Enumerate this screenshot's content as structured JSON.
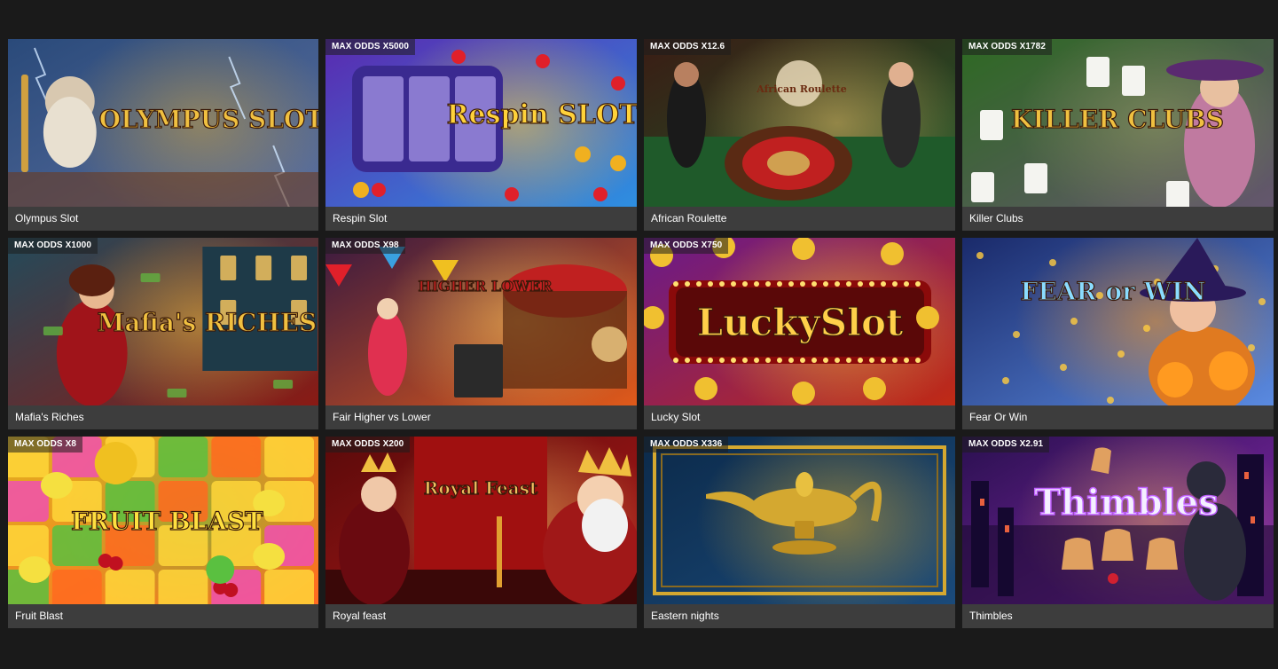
{
  "games": [
    {
      "title": "Olympus Slot",
      "badge": "",
      "logo": "OLYMPUS SLOT",
      "art": "zeus",
      "colors": [
        "#2a4a7a",
        "#5a6fa0",
        "#c9a040"
      ]
    },
    {
      "title": "Respin Slot",
      "badge": "MAX ODDS X5000",
      "logo": "Respin SLOT",
      "art": "respin",
      "colors": [
        "#5a2ab0",
        "#2e8fe0",
        "#ffd23a"
      ]
    },
    {
      "title": "African Roulette",
      "badge": "MAX ODDS X12.6",
      "logo": "African Roulette",
      "art": "roulette",
      "colors": [
        "#3a1c14",
        "#1f5a2a",
        "#e8c068"
      ]
    },
    {
      "title": "Killer Clubs",
      "badge": "MAX ODDS X1782",
      "logo": "KILLER CLUBS",
      "art": "killer",
      "colors": [
        "#2e6a22",
        "#8a4aa0",
        "#e0c090"
      ]
    },
    {
      "title": "Mafia's Riches",
      "badge": "MAX ODDS X1000",
      "logo": "Mafia's RICHES",
      "art": "mafia",
      "colors": [
        "#234a5a",
        "#8a1a14",
        "#f0c040"
      ]
    },
    {
      "title": "Fair Higher vs Lower",
      "badge": "MAX ODDS X98",
      "logo": "HIGHER LOWER",
      "art": "fair",
      "colors": [
        "#3a1a40",
        "#e05a1a",
        "#ffd060"
      ]
    },
    {
      "title": "Lucky Slot",
      "badge": "MAX ODDS X750",
      "logo": "LuckySlot",
      "art": "lucky",
      "colors": [
        "#6a1a8a",
        "#c02a14",
        "#ffcc30"
      ]
    },
    {
      "title": "Fear Or Win",
      "badge": "",
      "logo": "FEAR or WIN",
      "art": "fear",
      "colors": [
        "#1a2a6a",
        "#5a8ae0",
        "#ff9a20"
      ]
    },
    {
      "title": "Fruit Blast",
      "badge": "MAX ODDS X8",
      "logo": "FRUIT BLAST",
      "art": "fruit",
      "colors": [
        "#e0b020",
        "#ff6a20",
        "#5ac040"
      ]
    },
    {
      "title": "Royal feast",
      "badge": "MAX ODDS X200",
      "logo": "Royal Feast",
      "art": "royal",
      "colors": [
        "#5a0a0a",
        "#b01a1a",
        "#f0c060"
      ]
    },
    {
      "title": "Eastern nights",
      "badge": "MAX ODDS X336",
      "logo": "",
      "art": "lamp",
      "colors": [
        "#0c2a4a",
        "#1a4a7a",
        "#d4a830"
      ]
    },
    {
      "title": "Thimbles",
      "badge": "MAX ODDS X2.91",
      "logo": "Thimbles",
      "art": "thimbles",
      "colors": [
        "#2a1050",
        "#8a2ab0",
        "#e0a060"
      ]
    }
  ]
}
